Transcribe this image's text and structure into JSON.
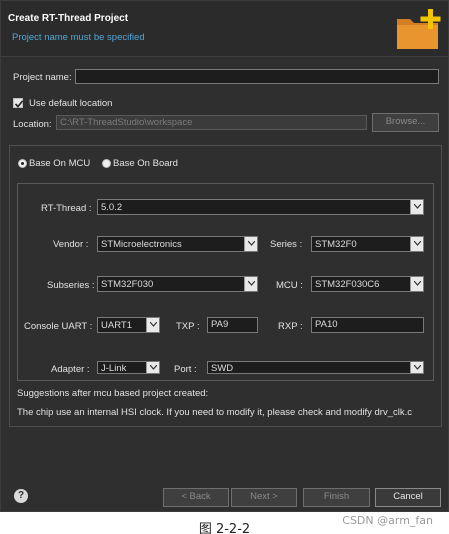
{
  "dialog": {
    "title": "Create RT-Thread Project",
    "message": "Project name must be specified",
    "icon": "folder-add-icon"
  },
  "project_name": {
    "label": "Project name:",
    "value": ""
  },
  "default_location": {
    "label": "Use default location",
    "checked": true
  },
  "location": {
    "label": "Location:",
    "value": "C:\\RT-ThreadStudio\\workspace",
    "browse_label": "Browse..."
  },
  "base": {
    "mcu_label": "Base On MCU",
    "board_label": "Base On Board",
    "selected": "mcu"
  },
  "fields": {
    "rtthread": {
      "label": "RT-Thread :",
      "value": "5.0.2"
    },
    "vendor": {
      "label": "Vendor :",
      "value": "STMicroelectronics"
    },
    "series": {
      "label": "Series :",
      "value": "STM32F0"
    },
    "subseries": {
      "label": "Subseries :",
      "value": "STM32F030"
    },
    "mcu": {
      "label": "MCU :",
      "value": "STM32F030C6"
    },
    "console_uart": {
      "label": "Console UART :",
      "value": "UART1"
    },
    "txp": {
      "label": "TXP :",
      "value": "PA9"
    },
    "rxp": {
      "label": "RXP :",
      "value": "PA10"
    },
    "adapter": {
      "label": "Adapter :",
      "value": "J-Link"
    },
    "port": {
      "label": "Port :",
      "value": "SWD"
    }
  },
  "suggestions": {
    "heading": "Suggestions after mcu based project created:",
    "text": "The chip use an internal HSI clock. If you need to modify it, please check and modify drv_clk.c"
  },
  "buttons": {
    "back": "< Back",
    "next": "Next >",
    "finish": "Finish",
    "cancel": "Cancel"
  },
  "caption": "图 2-2-2",
  "watermark": "CSDN @arm_fan",
  "colors": {
    "dialog_bg": "#2f2f2f",
    "message_text": "#4fa7d6",
    "folder_icon": "#e8952f"
  }
}
